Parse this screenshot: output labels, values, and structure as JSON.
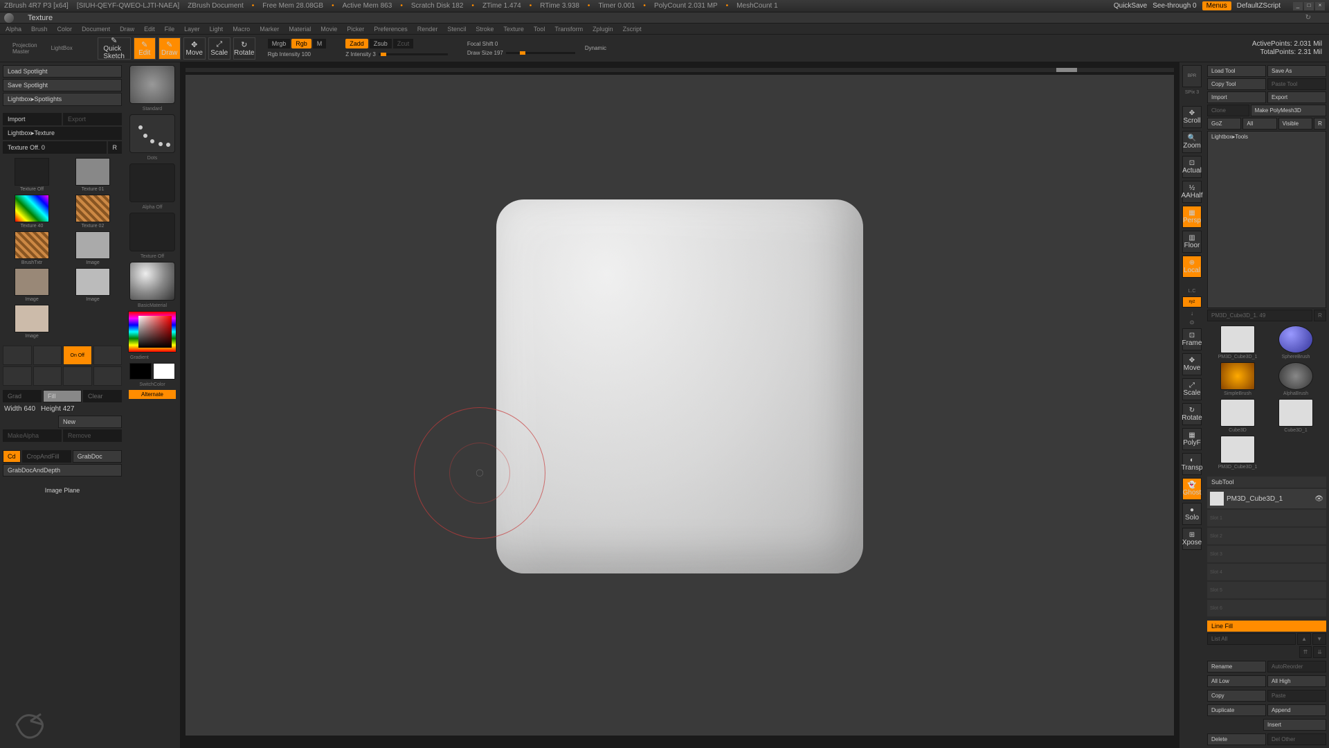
{
  "titlebar": {
    "app": "ZBrush 4R7 P3 [x64]",
    "doc_id": "[SIUH-QEYF-QWEO-LJTI-NAEA]",
    "doc": "ZBrush Document",
    "stats": [
      "Free Mem 28.08GB",
      "Active Mem 863",
      "Scratch Disk 182",
      "ZTime 1.474",
      "RTime 3.938",
      "Timer 0.001",
      "PolyCount 2.031 MP",
      "MeshCount 1"
    ],
    "quicksave": "QuickSave",
    "seethrough": "See-through   0",
    "menus": "Menus",
    "script": "DefaultZScript"
  },
  "subtitle": "Texture",
  "menus": [
    "Alpha",
    "Brush",
    "Color",
    "Document",
    "Draw",
    "Edit",
    "File",
    "Layer",
    "Light",
    "Macro",
    "Marker",
    "Material",
    "Movie",
    "Picker",
    "Preferences",
    "Render",
    "Stencil",
    "Stroke",
    "Texture",
    "Tool",
    "Transform",
    "Zplugin",
    "Zscript"
  ],
  "toolbar": {
    "projection": "Projection\nMaster",
    "lightbox": "LightBox",
    "quicksketch": "Quick\nSketch",
    "edit": "Edit",
    "draw": "Draw",
    "move": "Move",
    "scale": "Scale",
    "rotate": "Rotate",
    "mrgb": "Mrgb",
    "rgb": "Rgb",
    "m": "M",
    "rgb_intensity": "Rgb Intensity 100",
    "zadd": "Zadd",
    "zsub": "Zsub",
    "zcut": "Zcut",
    "z_intensity": "Z Intensity 3",
    "focal_shift": "Focal Shift 0",
    "draw_size": "Draw Size 197",
    "dynamic": "Dynamic",
    "active_points": "ActivePoints: 2.031 Mil",
    "total_points": "TotalPoints: 2.31 Mil"
  },
  "left": {
    "load_spotlight": "Load Spotlight",
    "save_spotlight": "Save Spotlight",
    "lightbox_spotlights": "Lightbox▸Spotlights",
    "import": "Import",
    "export": "Export",
    "lightbox_texture": "Lightbox▸Texture",
    "texture_off": "Texture Off. 0",
    "textures": [
      "Texture Off",
      "Texture 01",
      "Texture 40",
      "Texture 02",
      "BrushTxtr",
      "Image",
      "Image",
      "Image",
      "Image"
    ],
    "onoff": "On Off",
    "grad": "Grad",
    "fill": "Fill",
    "clear": "Clear",
    "width": "Width 640",
    "height": "Height 427",
    "new": "New",
    "makealpha": "MakeAlpha",
    "remove": "Remove",
    "cd": "Cd",
    "cropfill": "CropAndFill",
    "grabdoc": "GrabDoc",
    "grabdocdepth": "GrabDocAndDepth",
    "image_plane": "Image Plane"
  },
  "brush": {
    "standard": "Standard",
    "dots": "Dots",
    "alpha_off": "Alpha Off",
    "texture_off": "Texture Off",
    "basic_mat": "BasicMaterial",
    "gradient": "Gradient",
    "switchcolor": "SwitchColor",
    "alternate": "Alternate"
  },
  "right_tools": {
    "bpr": "BPR",
    "spix": "SPix 3",
    "scroll": "Scroll",
    "zoom": "Zoom",
    "actual": "Actual",
    "aahalf": "AAHalf",
    "persp": "Persp",
    "floor": "Floor",
    "local": "Local",
    "lc": "L.C",
    "xyz": "xyz",
    "frame": "Frame",
    "move": "Move",
    "scale": "Scale",
    "rotate": "Rotate",
    "polyf": "PolyF",
    "transp": "Transp",
    "ghost": "Ghost",
    "solo": "Solo",
    "xpose": "Xpose"
  },
  "right": {
    "load_tool": "Load Tool",
    "save_as": "Save As",
    "copy_tool": "Copy Tool",
    "paste_tool": "Paste Tool",
    "import": "Import",
    "export": "Export",
    "clone": "Clone",
    "make_polymesh": "Make PolyMesh3D",
    "goz": "GoZ",
    "all": "All",
    "visible": "Visible",
    "r": "R",
    "lightbox_tools": "Lightbox▸Tools",
    "current_tool": "PM3D_Cube3D_1. 49",
    "tools": [
      "PM3D_Cube3D_1",
      "SphereBrush",
      "SimpleBrush",
      "AlphaBrush",
      "Cube3D",
      "Cube3D_1",
      "PM3D_Cube3D_1"
    ],
    "subtool": "SubTool",
    "subtool_name": "PM3D_Cube3D_1",
    "line_fill": "Line Fill",
    "list_all": "List All",
    "rename": "Rename",
    "autoreorder": "AutoReorder",
    "all_low": "All Low",
    "all_high": "All High",
    "copy": "Copy",
    "paste": "Paste",
    "duplicate": "Duplicate",
    "append": "Append",
    "insert": "Insert",
    "delete": "Delete",
    "del_other": "Del Other",
    "slots": [
      "Slot 1",
      "Slot 2",
      "Slot 3",
      "Slot 4",
      "Slot 5",
      "Slot 6"
    ]
  }
}
